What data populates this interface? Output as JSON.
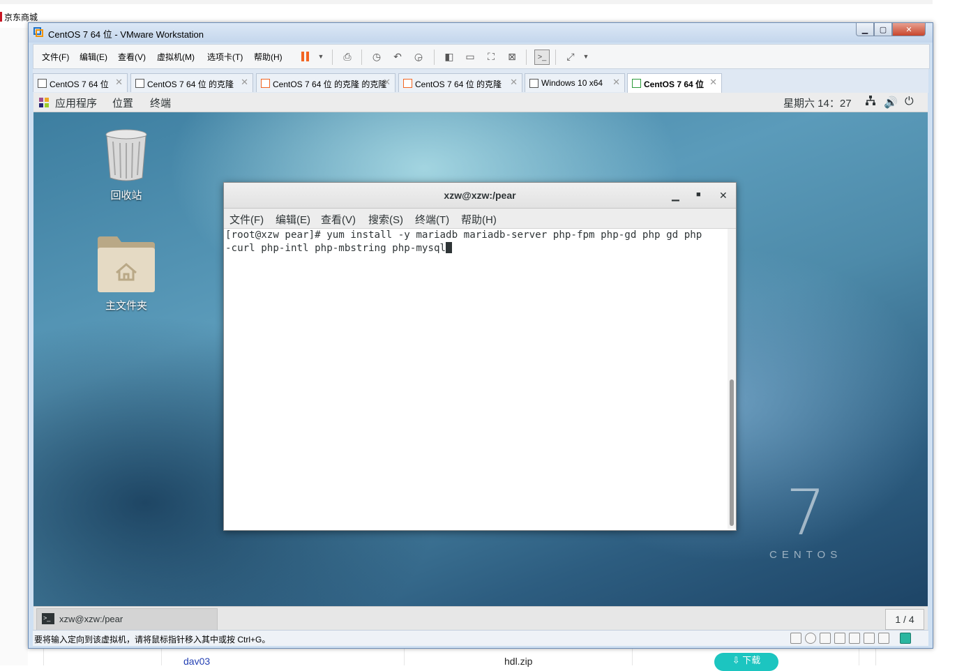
{
  "browser": {
    "bookmark_label": "京东商城",
    "table_link": "dav03",
    "table_file": "hdl.zip",
    "download_button": "⇩ 下载"
  },
  "vmware": {
    "title": "CentOS 7 64 位 - VMware Workstation",
    "menus": [
      "文件(F)",
      "编辑(E)",
      "查看(V)",
      "虚拟机(M)",
      "选项卡(T)",
      "帮助(H)"
    ],
    "tabs": [
      {
        "label": "CentOS 7 64 位",
        "active": false
      },
      {
        "label": "CentOS 7 64 位 的克隆",
        "active": false
      },
      {
        "label": "CentOS 7 64 位 的克隆 的克隆",
        "active": false
      },
      {
        "label": "CentOS 7 64 位 的克隆",
        "active": false
      },
      {
        "label": "Windows 10 x64",
        "active": false
      },
      {
        "label": "CentOS 7 64 位",
        "active": true
      }
    ],
    "status_text": "要将输入定向到该虚拟机，请将鼠标指针移入其中或按 Ctrl+G。",
    "accent": "#f26522"
  },
  "gnome": {
    "top_menus": [
      "应用程序",
      "位置",
      "终端"
    ],
    "clock": "星期六 14：27",
    "desktop_icons": [
      {
        "label": "回收站",
        "icon": "trash-icon"
      },
      {
        "label": "主文件夹",
        "icon": "home-folder-icon"
      }
    ],
    "brand_number": "7",
    "brand_word": "CENTOS",
    "taskbar_item": "xzw@xzw:/pear",
    "workspace": "1 / 4"
  },
  "terminal": {
    "title": "xzw@xzw:/pear",
    "menus": [
      "文件(F)",
      "编辑(E)",
      "查看(V)",
      "搜索(S)",
      "终端(T)",
      "帮助(H)"
    ],
    "line1": "[root@xzw pear]# yum install -y mariadb mariadb-server php-fpm php-gd php gd php",
    "line2": "-curl php-intl php-mbstring php-mysql"
  }
}
